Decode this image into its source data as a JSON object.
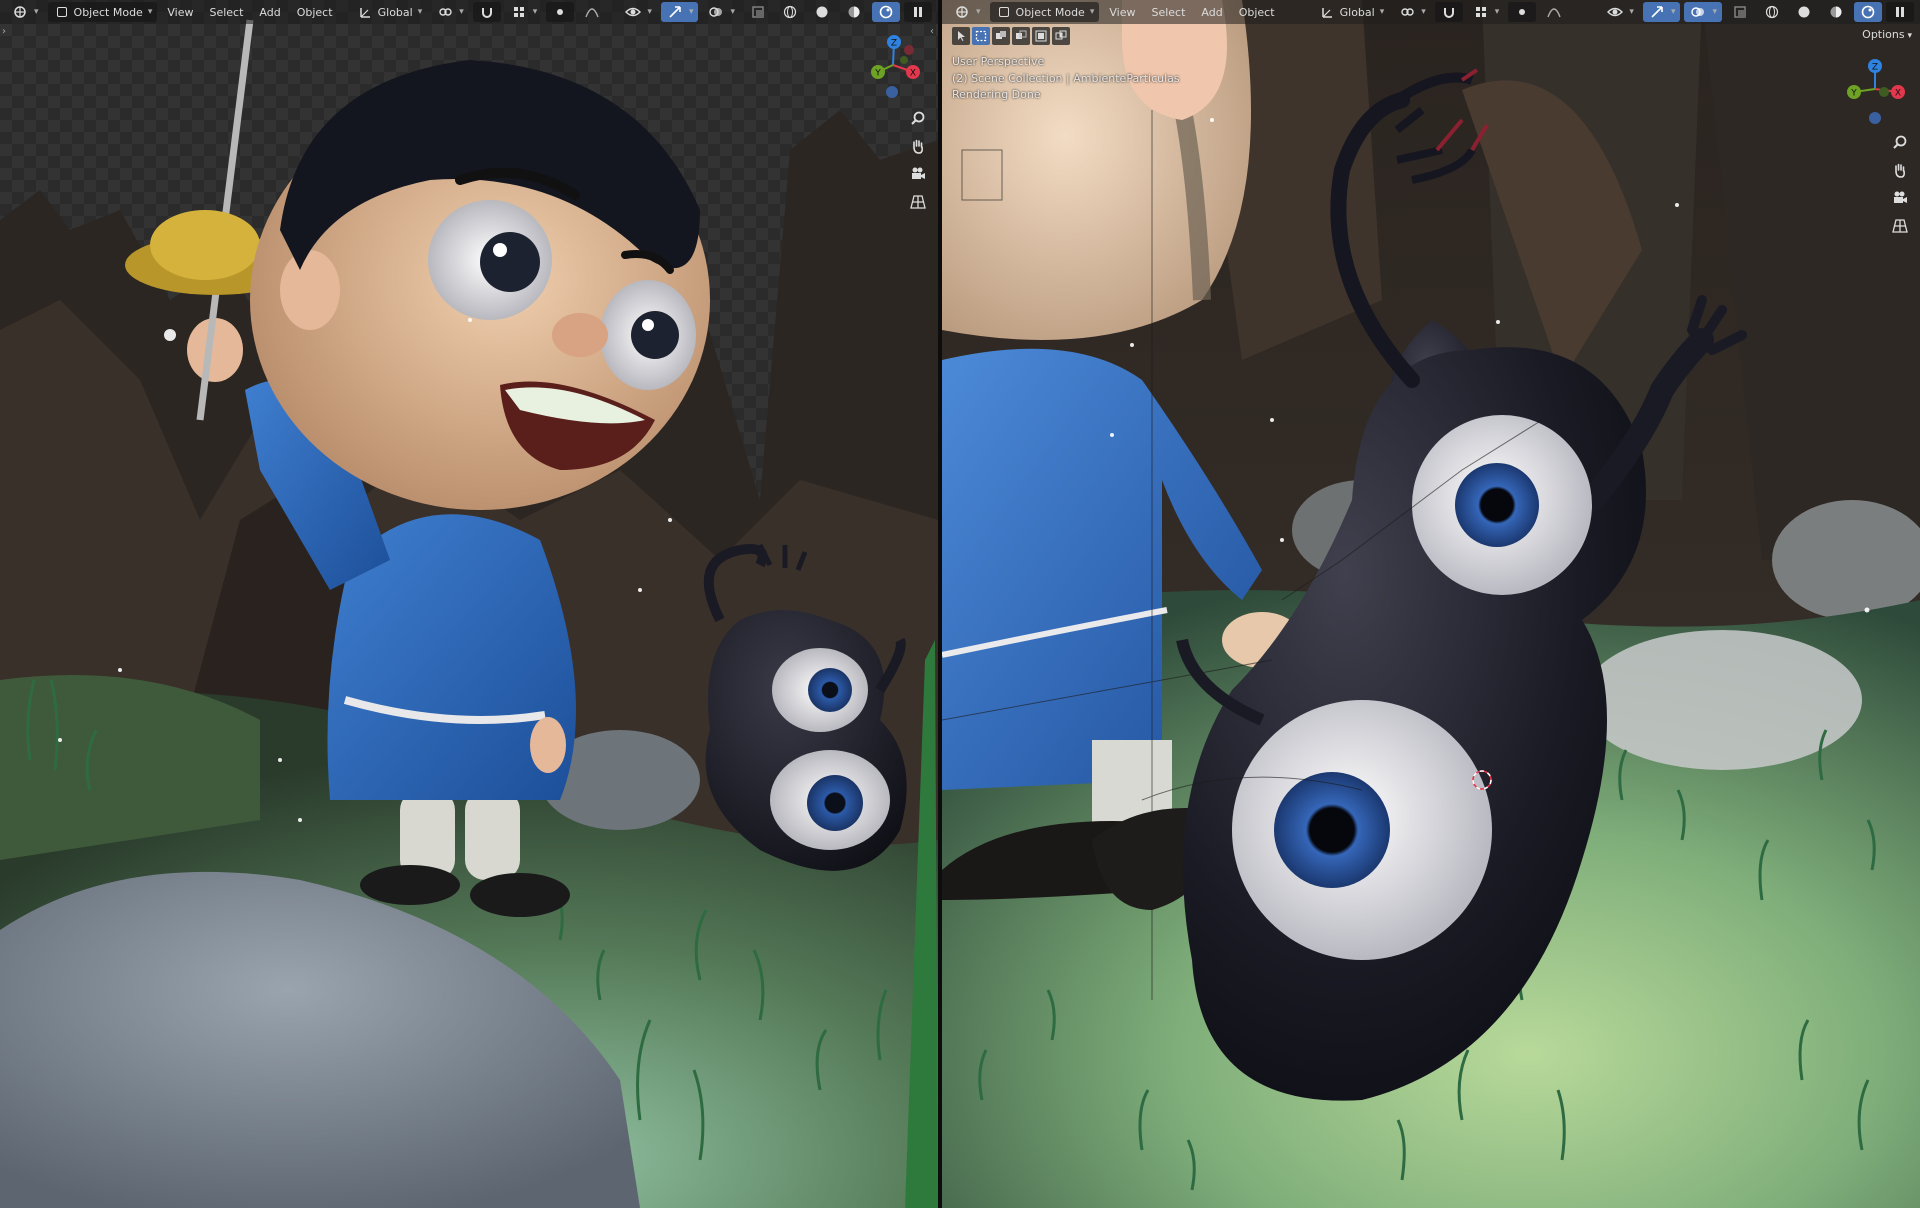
{
  "left_viewport": {
    "header": {
      "mode_label": "Object Mode",
      "menu_view": "View",
      "menu_select": "Select",
      "menu_add": "Add",
      "menu_object": "Object",
      "orientation_label": "Global"
    },
    "gizmo": {
      "z": "Z",
      "y": "Y",
      "x": "X"
    }
  },
  "right_viewport": {
    "header": {
      "mode_label": "Object Mode",
      "menu_view": "View",
      "menu_select": "Select",
      "menu_add": "Add",
      "menu_object": "Object",
      "orientation_label": "Global"
    },
    "options_label": "Options",
    "overlay": {
      "perspective": "User Perspective",
      "collection": "(2) Scene Collection | AmbienteParticulas",
      "status": "Rendering Done"
    },
    "gizmo": {
      "z": "Z",
      "y": "Y",
      "x": "X"
    }
  },
  "colors": {
    "accent_blue": "#4772b3",
    "axis_x": "#e2374c",
    "axis_y": "#6ea224",
    "axis_z": "#2f82e0",
    "axis_neg": "#3a60a0"
  }
}
